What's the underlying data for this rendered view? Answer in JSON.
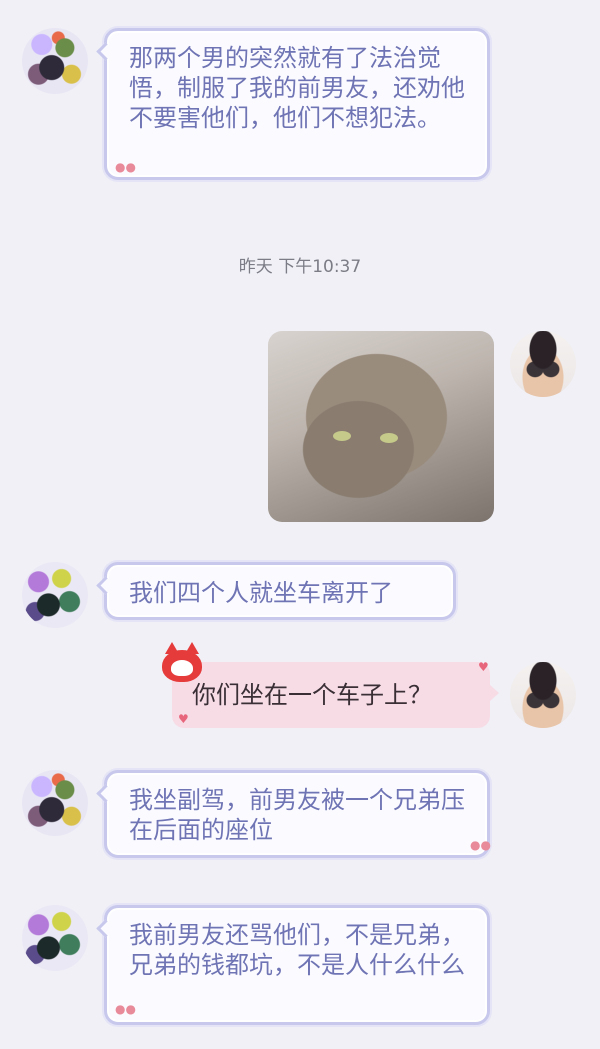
{
  "messages": [
    {
      "side": "left",
      "text": "那两个男的突然就有了法治觉悟，制服了我的前男友，还劝他不要害他们，他们不想犯法。"
    },
    {
      "side": "timestamp",
      "text": "昨天 下午10:37"
    },
    {
      "side": "right",
      "type": "image",
      "image_desc": "cat-photo"
    },
    {
      "side": "left",
      "text": "我们四个人就坐车离开了"
    },
    {
      "side": "right",
      "text": "你们坐在一个车子上？"
    },
    {
      "side": "left",
      "text": "我坐副驾，前男友被一个兄弟压在后面的座位"
    },
    {
      "side": "left",
      "text": "我前男友还骂他们，不是兄弟，兄弟的钱都坑，不是人什么什么"
    }
  ],
  "colors": {
    "background": "#f0f0f6",
    "left_bubble_text": "#6f74b4",
    "left_bubble_border": "#c7c8ec",
    "right_bubble_bg": "#f7dce6"
  }
}
